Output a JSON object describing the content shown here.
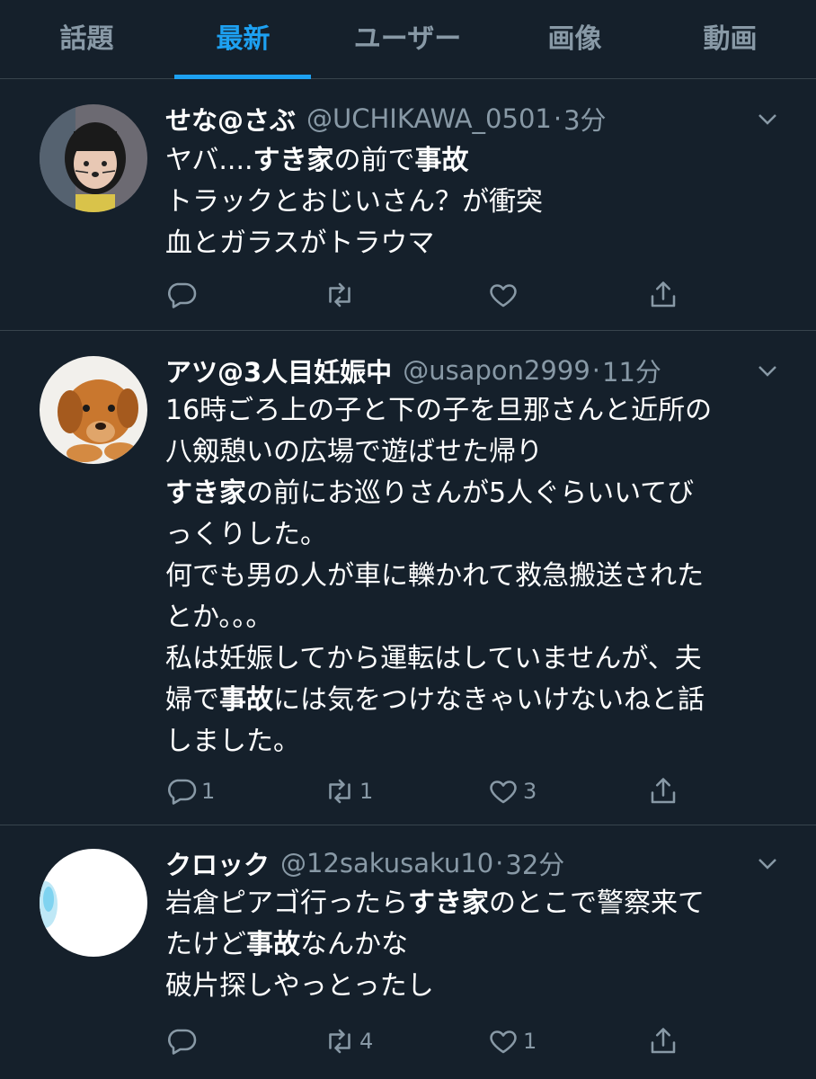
{
  "tabs": [
    {
      "label": "話題",
      "active": false
    },
    {
      "label": "最新",
      "active": true
    },
    {
      "label": "ユーザー",
      "active": false
    },
    {
      "label": "画像",
      "active": false
    },
    {
      "label": "動画",
      "active": false
    }
  ],
  "colors": {
    "background": "#15202b",
    "accent": "#1da1f2",
    "secondary_text": "#8899a6",
    "divider": "#38444d"
  },
  "tweets": [
    {
      "name": "せな@さぶ",
      "handle": "@UCHIKAWA_0501",
      "dot": "·",
      "time": "3分",
      "lines": [
        [
          {
            "t": "ヤバ....",
            "b": false
          },
          {
            "t": "すき家",
            "b": true
          },
          {
            "t": "の前で",
            "b": false
          },
          {
            "t": "事故",
            "b": true
          }
        ],
        [
          {
            "t": "トラックとおじいさん？が衝突",
            "b": false
          }
        ],
        [
          {
            "t": "血とガラスがトラウマ",
            "b": false
          }
        ]
      ],
      "reply_count": "",
      "retweet_count": "",
      "like_count": ""
    },
    {
      "name": "アツ@3人目妊娠中",
      "handle": "@usapon2999",
      "dot": "·",
      "time": "11分",
      "lines": [
        [
          {
            "t": "16時ごろ上の子と下の子を旦那さんと近所の",
            "b": false
          }
        ],
        [
          {
            "t": "八剱憩いの広場で遊ばせた帰り",
            "b": false
          }
        ],
        [
          {
            "t": "すき家",
            "b": true
          },
          {
            "t": "の前にお巡りさんが5人ぐらいいてび",
            "b": false
          }
        ],
        [
          {
            "t": "っくりした。",
            "b": false
          }
        ],
        [
          {
            "t": "何でも男の人が車に轢かれて救急搬送された",
            "b": false
          }
        ],
        [
          {
            "t": "とか。。。",
            "b": false
          }
        ],
        [
          {
            "t": "私は妊娠してから運転はしていませんが、夫",
            "b": false
          }
        ],
        [
          {
            "t": "婦で",
            "b": false
          },
          {
            "t": "事故",
            "b": true
          },
          {
            "t": "には気をつけなきゃいけないねと話",
            "b": false
          }
        ],
        [
          {
            "t": "しました。",
            "b": false
          }
        ]
      ],
      "reply_count": "1",
      "retweet_count": "1",
      "like_count": "3"
    },
    {
      "name": "クロック",
      "handle": "@12sakusaku10",
      "dot": "·",
      "time": "32分",
      "lines": [
        [
          {
            "t": "岩倉ピアゴ行ったら",
            "b": false
          },
          {
            "t": "すき家",
            "b": true
          },
          {
            "t": "のとこで警察来て",
            "b": false
          }
        ],
        [
          {
            "t": "たけど",
            "b": false
          },
          {
            "t": "事故",
            "b": true
          },
          {
            "t": "なんかな",
            "b": false
          }
        ],
        [
          {
            "t": "破片探しやっとったし",
            "b": false
          }
        ]
      ],
      "reply_count": "",
      "retweet_count": "4",
      "like_count": "1"
    }
  ]
}
